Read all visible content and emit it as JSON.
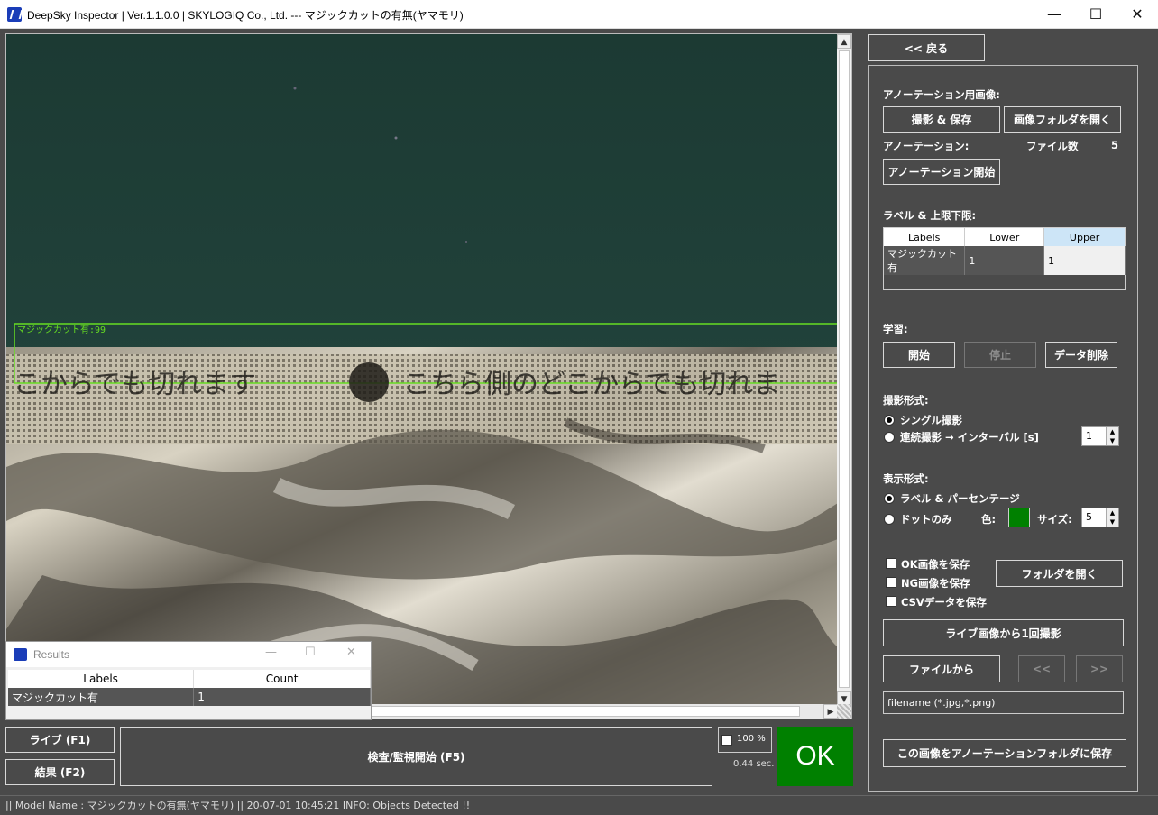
{
  "window": {
    "title": "DeepSky Inspector | Ver.1.1.0.0 | SKYLOGIQ Co., Ltd. --- マジックカットの有無(ヤマモリ)",
    "minimize": "—",
    "maximize": "☐",
    "close": "✕"
  },
  "viewer": {
    "detection_label": "マジックカット有:99",
    "package_text_left": "こからでも切れます",
    "package_text_right": "こちら側のどこからでも切れま",
    "scroll_up": "▲",
    "scroll_down": "▼",
    "scroll_right": "▶"
  },
  "results_window": {
    "title": "Results",
    "columns": [
      "Labels",
      "Count"
    ],
    "rows": [
      [
        "マジックカット有",
        "1"
      ]
    ]
  },
  "bottom": {
    "live_button": "ライブ (F1)",
    "result_button": "結果 (F2)",
    "inspect_button": "検査/監視開始 (F5)",
    "zoom_label": "100 %",
    "elapsed": "0.44 sec.",
    "verdict": "OK",
    "colors": {
      "verdict_bg": "#008000",
      "bg": "#4a4a4a",
      "detect_box": "#66dd22"
    }
  },
  "status": {
    "text": "|| Model Name : マジックカットの有無(ヤマモリ) ||    20-07-01 10:45:21   INFO:   Objects Detected !!"
  },
  "panel": {
    "back_button": "<< 戻る",
    "annotation_images_label": "アノーテーション用画像:",
    "capture_save_button": "撮影 & 保存",
    "open_image_folder_button": "画像フォルダを開く",
    "annotation_label": "アノーテーション:",
    "file_count_label": "ファイル数",
    "file_count": "5",
    "start_annotation_button": "アノーテーション開始",
    "label_limits_label": "ラベル & 上限下限:",
    "label_table": {
      "columns": [
        "Labels",
        "Lower",
        "Upper"
      ],
      "rows": [
        [
          "マジックカット有",
          "1",
          "1"
        ]
      ]
    },
    "training_label": "学習:",
    "train_start_button": "開始",
    "train_stop_button": "停止",
    "delete_data_button": "データ削除",
    "capture_mode_label": "撮影形式:",
    "single_capture": "シングル撮影",
    "continuous_capture": "連続撮影 → インターバル [s]",
    "interval_value": "1",
    "display_mode_label": "表示形式:",
    "label_percentage": "ラベル & パーセンテージ",
    "dot_only": "ドットのみ",
    "color_label": "色:",
    "dot_color": "#008000",
    "size_label": "サイズ:",
    "size_value": "5",
    "save_ok_images": "OK画像を保存",
    "save_ng_images": "NG画像を保存",
    "save_csv": "CSVデータを保存",
    "open_folder_button": "フォルダを開く",
    "capture_from_live_button": "ライブ画像から1回撮影",
    "from_file_button": "ファイルから",
    "prev_button": "<<",
    "next_button": ">>",
    "filename_value": "filename (*.jpg,*.png)",
    "save_to_annotation_button": "この画像をアノーテーションフォルダに保存"
  }
}
